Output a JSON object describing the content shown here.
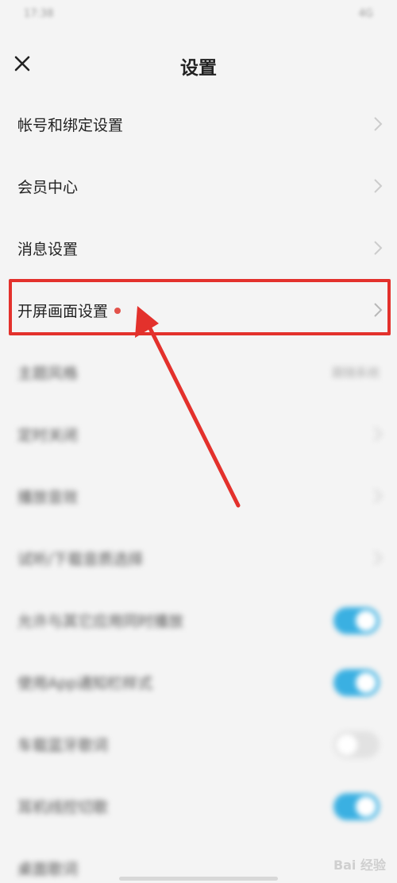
{
  "status_bar": {
    "left": "17:38",
    "right": "4G"
  },
  "header": {
    "title": "设置"
  },
  "rows": [
    {
      "label": "帐号和绑定设置"
    },
    {
      "label": "会员中心"
    },
    {
      "label": "消息设置"
    },
    {
      "label": "开屏画面设置",
      "has_dot": true
    },
    {
      "label": "主题风格",
      "value": "跟随系统"
    },
    {
      "label": "定时关闭"
    },
    {
      "label": "播放音效"
    },
    {
      "label": "试听/下载音质选择"
    },
    {
      "label": "允许与其它应用同时播放",
      "toggle_on": true
    },
    {
      "label": "使用App通知栏样式",
      "toggle_on": true
    },
    {
      "label": "车载蓝牙歌词",
      "toggle_on": false
    },
    {
      "label": "耳机线控切歌",
      "toggle_on": true
    },
    {
      "label": "桌面歌词"
    }
  ],
  "watermark": "Bai 经验",
  "colors": {
    "accent_toggle": "#3ab0e2",
    "highlight": "#e3312c",
    "dot": "#e2524a"
  }
}
